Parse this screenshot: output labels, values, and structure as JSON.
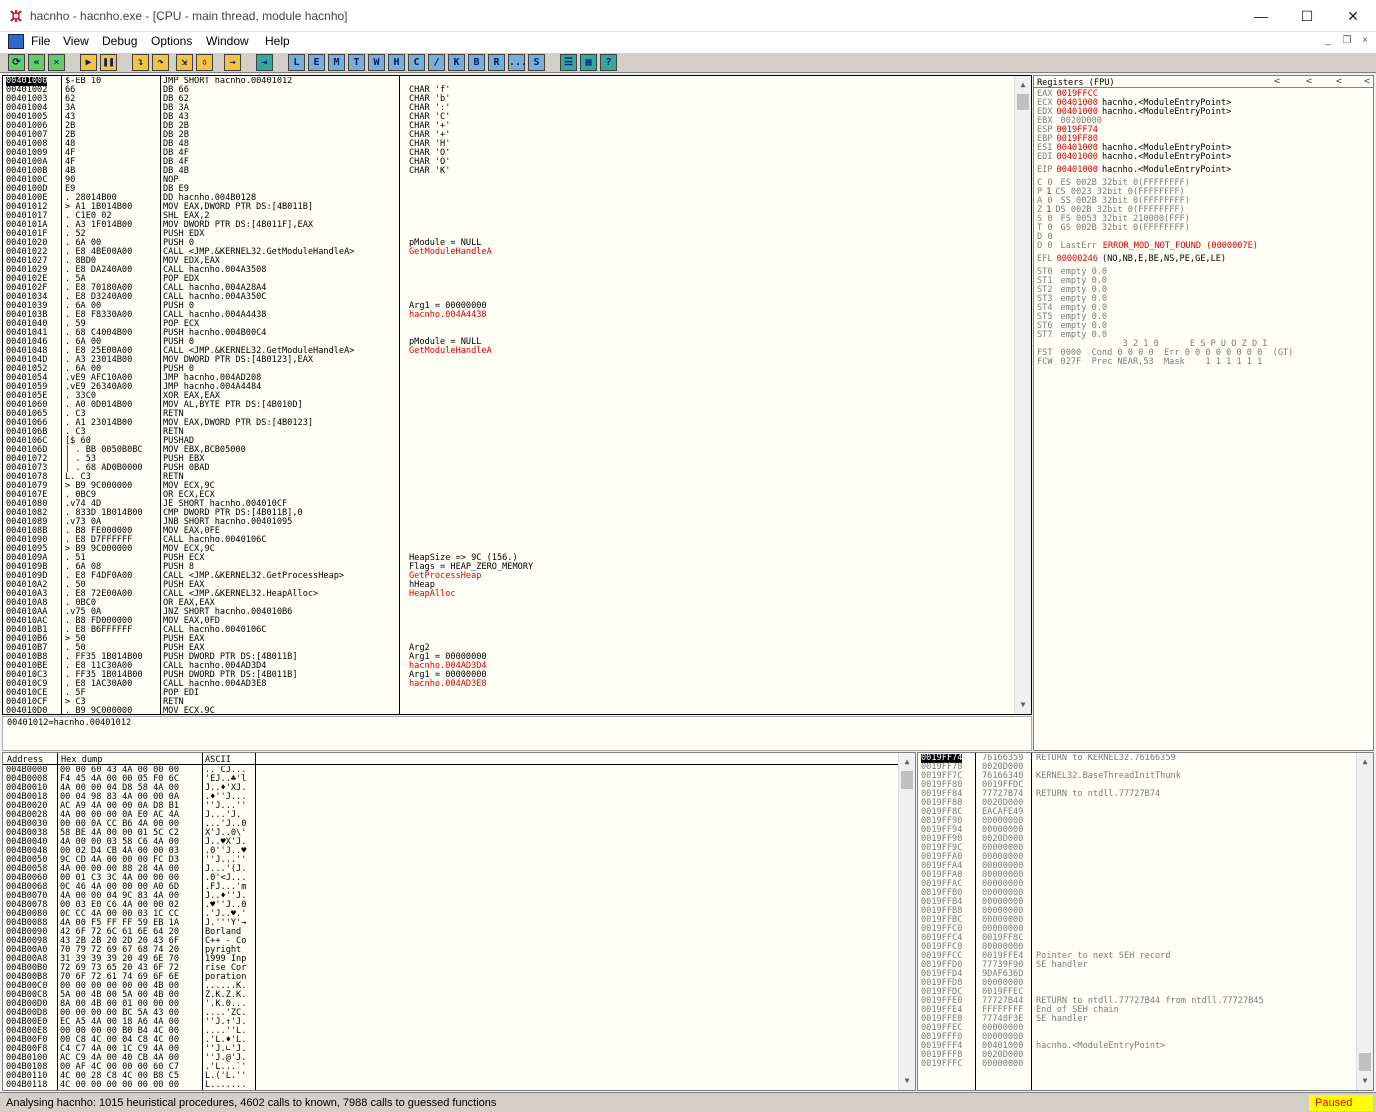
{
  "window": {
    "title": "hacnho - hacnho.exe - [CPU - main thread, module hacnho]",
    "minimize": "—",
    "maximize": "☐",
    "close": "✕"
  },
  "menu": [
    "File",
    "View",
    "Debug",
    "Options",
    "Window",
    "Help"
  ],
  "mdi": {
    "min": "_",
    "restore": "❐",
    "close": "×"
  },
  "toolbar": {
    "letters": [
      "L",
      "E",
      "M",
      "T",
      "W",
      "H",
      "C",
      "/",
      "K",
      "B",
      "R",
      "...",
      "S"
    ]
  },
  "cpu": {
    "rows": [
      [
        "00401000",
        "$-EB 10",
        "JMP SHORT hacnho.00401012",
        ""
      ],
      [
        "00401002",
        "66",
        "DB 66",
        "CHAR 'f'"
      ],
      [
        "00401003",
        "62",
        "DB 62",
        "CHAR 'b'"
      ],
      [
        "00401004",
        "3A",
        "DB 3A",
        "CHAR ':'"
      ],
      [
        "00401005",
        "43",
        "DB 43",
        "CHAR 'C'"
      ],
      [
        "00401006",
        "2B",
        "DB 2B",
        "CHAR '+'"
      ],
      [
        "00401007",
        "2B",
        "DB 2B",
        "CHAR '+'"
      ],
      [
        "00401008",
        "48",
        "DB 48",
        "CHAR 'H'"
      ],
      [
        "00401009",
        "4F",
        "DB 4F",
        "CHAR 'O'"
      ],
      [
        "0040100A",
        "4F",
        "DB 4F",
        "CHAR 'O'"
      ],
      [
        "0040100B",
        "4B",
        "DB 4B",
        "CHAR 'K'"
      ],
      [
        "0040100C",
        "90",
        "NOP",
        ""
      ],
      [
        "0040100D",
        "E9",
        "DB E9",
        ""
      ],
      [
        "0040100E",
        ". 28014B00",
        "DD hacnho.004B0128",
        ""
      ],
      [
        "00401012",
        "> A1 1B014B00",
        "MOV EAX,DWORD PTR DS:[4B011B]",
        ""
      ],
      [
        "00401017",
        ". C1E0 02",
        "SHL EAX,2",
        ""
      ],
      [
        "0040101A",
        ". A3 1F014B00",
        "MOV DWORD PTR DS:[4B011F],EAX",
        ""
      ],
      [
        "0040101F",
        ". 52",
        "PUSH EDX",
        ""
      ],
      [
        "00401020",
        ". 6A 00",
        "PUSH 0",
        "pModule = NULL"
      ],
      [
        "00401022",
        ". E8 4BE00A00",
        "CALL <JMP.&KERNEL32.GetModuleHandleA>",
        "GetModuleHandleA"
      ],
      [
        "00401027",
        ". 8BD0",
        "MOV EDX,EAX",
        ""
      ],
      [
        "00401029",
        ". E8 DA240A00",
        "CALL hacnho.004A3508",
        ""
      ],
      [
        "0040102E",
        ". 5A",
        "POP EDX",
        ""
      ],
      [
        "0040102F",
        ". E8 70180A00",
        "CALL hacnho.004A28A4",
        ""
      ],
      [
        "00401034",
        ". E8 D3240A00",
        "CALL hacnho.004A350C",
        ""
      ],
      [
        "00401039",
        ". 6A 00",
        "PUSH 0",
        "Arg1 = 00000000"
      ],
      [
        "0040103B",
        ". E8 F8330A00",
        "CALL hacnho.004A4438",
        "hacnho.004A4438"
      ],
      [
        "00401040",
        ". 59",
        "POP ECX",
        ""
      ],
      [
        "00401041",
        ". 68 C4004B00",
        "PUSH hacnho.004B00C4",
        ""
      ],
      [
        "00401046",
        ". 6A 00",
        "PUSH 0",
        "pModule = NULL"
      ],
      [
        "00401048",
        ". E8 25E00A00",
        "CALL <JMP.&KERNEL32.GetModuleHandleA>",
        "GetModuleHandleA"
      ],
      [
        "0040104D",
        ". A3 23014B00",
        "MOV DWORD PTR DS:[4B0123],EAX",
        ""
      ],
      [
        "00401052",
        ". 6A 00",
        "PUSH 0",
        ""
      ],
      [
        "00401054",
        ".vE9 AFC10A00",
        "JMP hacnho.004AD208",
        ""
      ],
      [
        "00401059",
        ".vE9 26340A00",
        "JMP hacnho.004A4484",
        ""
      ],
      [
        "0040105E",
        ". 33C0",
        "XOR EAX,EAX",
        ""
      ],
      [
        "00401060",
        ". A0 0D014B00",
        "MOV AL,BYTE PTR DS:[4B010D]",
        ""
      ],
      [
        "00401065",
        ". C3",
        "RETN",
        ""
      ],
      [
        "00401066",
        ". A1 23014B00",
        "MOV EAX,DWORD PTR DS:[4B0123]",
        ""
      ],
      [
        "0040106B",
        ". C3",
        "RETN",
        ""
      ],
      [
        "0040106C",
        "[$ 60",
        "PUSHAD",
        ""
      ],
      [
        "0040106D",
        "| . BB 0050B0BC",
        "MOV EBX,BCB05000",
        ""
      ],
      [
        "00401072",
        "| . 53",
        "PUSH EBX",
        ""
      ],
      [
        "00401073",
        "| . 68 AD0B0000",
        "PUSH 0BAD",
        ""
      ],
      [
        "00401078",
        "L. C3",
        "RETN",
        ""
      ],
      [
        "00401079",
        "> B9 9C000000",
        "MOV ECX,9C",
        ""
      ],
      [
        "0040107E",
        ". 0BC9",
        "OR ECX,ECX",
        ""
      ],
      [
        "00401080",
        ".v74 4D",
        "JE SHORT hacnho.004010CF",
        ""
      ],
      [
        "00401082",
        ". 833D 1B014B00",
        "CMP DWORD PTR DS:[4B011B],0",
        ""
      ],
      [
        "00401089",
        ".v73 0A",
        "JNB SHORT hacnho.00401095",
        ""
      ],
      [
        "0040108B",
        ". B8 FE000000",
        "MOV EAX,0FE",
        ""
      ],
      [
        "00401090",
        ". E8 D7FFFFFF",
        "CALL hacnho.0040106C",
        ""
      ],
      [
        "00401095",
        "> B9 9C000000",
        "MOV ECX,9C",
        ""
      ],
      [
        "0040109A",
        ". 51",
        "PUSH ECX",
        "HeapSize => 9C (156.)"
      ],
      [
        "0040109B",
        ". 6A 08",
        "PUSH 8",
        "Flags = HEAP_ZERO_MEMORY"
      ],
      [
        "0040109D",
        ". E8 F4DF0A00",
        "CALL <JMP.&KERNEL32.GetProcessHeap>",
        "GetProcessHeap"
      ],
      [
        "004010A2",
        ". 50",
        "PUSH EAX",
        "hHeap"
      ],
      [
        "004010A3",
        ". E8 72E00A00",
        "CALL <JMP.&KERNEL32.HeapAlloc>",
        "HeapAlloc"
      ],
      [
        "004010A8",
        ". 0BC0",
        "OR EAX,EAX",
        ""
      ],
      [
        "004010AA",
        ".v75 0A",
        "JNZ SHORT hacnho.004010B6",
        ""
      ],
      [
        "004010AC",
        ". B8 FD000000",
        "MOV EAX,0FD",
        ""
      ],
      [
        "004010B1",
        ". E8 B6FFFFFF",
        "CALL hacnho.0040106C",
        ""
      ],
      [
        "004010B6",
        "> 50",
        "PUSH EAX",
        ""
      ],
      [
        "004010B7",
        ". 50",
        "PUSH EAX",
        "Arg2"
      ],
      [
        "004010B8",
        ". FF35 1B014B00",
        "PUSH DWORD PTR DS:[4B011B]",
        "Arg1 = 00000000"
      ],
      [
        "004010BE",
        ". E8 11C30A00",
        "CALL hacnho.004AD3D4",
        "hacnho.004AD3D4"
      ],
      [
        "004010C3",
        ". FF35 1B014B00",
        "PUSH DWORD PTR DS:[4B011B]",
        "Arg1 = 00000000"
      ],
      [
        "004010C9",
        ". E8 1AC30A00",
        "CALL hacnho.004AD3E8",
        "hacnho.004AD3E8"
      ],
      [
        "004010CE",
        ". 5F",
        "POP EDI",
        ""
      ],
      [
        "004010CF",
        "> C3",
        "RETN",
        ""
      ],
      [
        "004010D0",
        ". B9 9C000000",
        "MOV ECX,9C",
        ""
      ]
    ]
  },
  "info": {
    "text": "00401012=hacnho.00401012"
  },
  "registers": {
    "title": "Registers (FPU)",
    "lines": [
      {
        "k": "EAX",
        "v": "0019FFCC",
        "n": ""
      },
      {
        "k": "ECX",
        "v": "00401000",
        "n": "hacnho.<ModuleEntryPoint>"
      },
      {
        "k": "EDX",
        "v": "00401000",
        "n": "hacnho.<ModuleEntryPoint>"
      },
      {
        "k": "EBX",
        "v": "",
        "n": "",
        "g": "0020D000"
      },
      {
        "k": "ESP",
        "v": "0019FF74",
        "n": ""
      },
      {
        "k": "EBP",
        "v": "0019FF80",
        "n": ""
      },
      {
        "k": "ESI",
        "v": "00401000",
        "n": "hacnho.<ModuleEntryPoint>"
      },
      {
        "k": "EDI",
        "v": "00401000",
        "n": "hacnho.<ModuleEntryPoint>"
      },
      {
        "k": "",
        "v": "",
        "n": ""
      },
      {
        "k": "EIP",
        "v": "00401000",
        "n": "hacnho.<ModuleEntryPoint>"
      },
      {
        "k": "",
        "v": "",
        "n": ""
      },
      {
        "k": "C 0",
        "v": "",
        "n": "",
        "g": "ES 002B 32bit 0(FFFFFFFF)"
      },
      {
        "k": "P",
        "v": "1",
        "n": "",
        "g": "CS 0023 32bit 0(FFFFFFFF)"
      },
      {
        "k": "A 0",
        "v": "",
        "n": "",
        "g": "SS 002B 32bit 0(FFFFFFFF)"
      },
      {
        "k": "Z",
        "v": "1",
        "n": "",
        "g": "DS 002B 32bit 0(FFFFFFFF)"
      },
      {
        "k": "S 0",
        "v": "",
        "n": "",
        "g": "FS 0053 32bit 210000(FFF)"
      },
      {
        "k": "T 0",
        "v": "",
        "n": "",
        "g": "GS 002B 32bit 0(FFFFFFFF)"
      },
      {
        "k": "D 0",
        "v": "",
        "n": ""
      },
      {
        "k": "O 0",
        "v": "",
        "n": "",
        "g": "LastErr",
        "e": "ERROR_MOD_NOT_FOUND (0000007E)"
      },
      {
        "k": "",
        "v": "",
        "n": ""
      },
      {
        "k": "EFL",
        "v": "00000246",
        "n": "(NO,NB,E,BE,NS,PE,GE,LE)"
      },
      {
        "k": "",
        "v": "",
        "n": ""
      },
      {
        "k": "ST0",
        "v": "",
        "n": "",
        "g": "empty 0.0"
      },
      {
        "k": "ST1",
        "v": "",
        "n": "",
        "g": "empty 0.0"
      },
      {
        "k": "ST2",
        "v": "",
        "n": "",
        "g": "empty 0.0"
      },
      {
        "k": "ST3",
        "v": "",
        "n": "",
        "g": "empty 0.0"
      },
      {
        "k": "ST4",
        "v": "",
        "n": "",
        "g": "empty 0.0"
      },
      {
        "k": "ST5",
        "v": "",
        "n": "",
        "g": "empty 0.0"
      },
      {
        "k": "ST6",
        "v": "",
        "n": "",
        "g": "empty 0.0"
      },
      {
        "k": "ST7",
        "v": "",
        "n": "",
        "g": "empty 0.0"
      },
      {
        "k": "",
        "v": "",
        "n": "",
        "g": "               3 2 1 0      E S P U O Z D I"
      },
      {
        "k": "FST",
        "v": "",
        "n": "",
        "g": "0000  Cond 0 0 0 0  Err 0 0 0 0 0 0 0 0  (GT)"
      },
      {
        "k": "FCW",
        "v": "",
        "n": "",
        "g": "027F  Prec NEAR,53  Mask    1 1 1 1 1 1"
      }
    ]
  },
  "dump": {
    "headers": {
      "address": "Address",
      "hex": "Hex dump",
      "ascii": "ASCII"
    },
    "rows": [
      [
        "004B0000",
        "00 00 60 43 4A 00 00 00",
        "..`CJ..."
      ],
      [
        "004B0008",
        "F4 45 4A 00 00 05 F0 6C",
        "'EJ..♣'l"
      ],
      [
        "004B0010",
        "4A 00 00 04 D8 58 4A 00",
        "J..♦'XJ."
      ],
      [
        "004B0018",
        "00 04 98 83 4A 00 00 0A",
        ".♦''J..."
      ],
      [
        "004B0020",
        "AC A9 4A 00 00 0A D8 B1",
        "''J...''"
      ],
      [
        "004B0028",
        "4A 00 00 00 0A E0 AC 4A",
        "J...'J."
      ],
      [
        "004B0030",
        "00 00 0A CC B6 4A 00 00",
        "...'J..0"
      ],
      [
        "004B0038",
        "58 BE 4A 00 00 01 5C C2",
        "X'J..0\\'"
      ],
      [
        "004B0040",
        "4A 00 00 03 58 C6 4A 00",
        "J..♥X'J."
      ],
      [
        "004B0048",
        "00 02 D4 CB 4A 00 00 03",
        ".0''J..♥"
      ],
      [
        "004B0050",
        "9C CD 4A 00 00 00 FC D3",
        "''J...''"
      ],
      [
        "004B0058",
        "4A 00 00 00 88 28 4A 00",
        "J...'(J."
      ],
      [
        "004B0060",
        "00 01 C3 3C 4A 00 00 00",
        ".0'<J..."
      ],
      [
        "004B0068",
        "0C 46 4A 00 00 00 A0 6D",
        ".FJ...'m"
      ],
      [
        "004B0070",
        "4A 00 00 04 9C 83 4A 00",
        "J..♦''J."
      ],
      [
        "004B0078",
        "00 03 E0 C6 4A 00 00 02",
        ".♥''J..0"
      ],
      [
        "004B0080",
        "0C CC 4A 00 00 03 1C CC",
        ".'J..♥.'"
      ],
      [
        "004B0088",
        "4A 00 F5 FF FF 59 EB 1A",
        "J.'''Y'→"
      ],
      [
        "004B0090",
        "42 6F 72 6C 61 6E 64 20",
        "Borland "
      ],
      [
        "004B0098",
        "43 2B 2B 20 2D 20 43 6F",
        "C++ - Co"
      ],
      [
        "004B00A0",
        "70 79 72 69 67 68 74 20",
        "pyright "
      ],
      [
        "004B00A8",
        "31 39 39 39 20 49 6E 70",
        "1999 Inp"
      ],
      [
        "004B00B0",
        "72 69 73 65 20 43 6F 72",
        "rise Cor"
      ],
      [
        "004B00B8",
        "70 6F 72 61 74 69 6F 6E",
        "poration"
      ],
      [
        "004B00C0",
        "00 00 00 00 00 00 4B 00",
        "......K."
      ],
      [
        "004B00C8",
        "5A 00 4B 00 5A 00 4B 00",
        "Z.K.Z.K."
      ],
      [
        "004B00D0",
        "8A 00 4B 00 01 00 00 00",
        "'.K.0..."
      ],
      [
        "004B00D8",
        "00 00 00 00 BC 5A 43 00",
        "....'ZC."
      ],
      [
        "004B00E0",
        "EC A5 4A 00 18 A6 4A 00",
        "''J.↑'J."
      ],
      [
        "004B00E8",
        "00 00 00 00 B0 B4 4C 00",
        "....''L."
      ],
      [
        "004B00F0",
        "00 C8 4C 00 04 C8 4C 00",
        ".'L.♦'L."
      ],
      [
        "004B00F8",
        "C4 C7 4A 00 1C C9 4A 00",
        "''J.∟'J."
      ],
      [
        "004B0100",
        "AC C9 4A 00 40 CB 4A 00",
        "''J.@'J."
      ],
      [
        "004B0108",
        "00 AF 4C 00 00 00 60 C7",
        ".'L...`'"
      ],
      [
        "004B0110",
        "4C 00 28 C8 4C 00 B8 C5",
        "L.('L.''"
      ],
      [
        "004B0118",
        "4C 00 00 00 00 00 00 00",
        "L......."
      ]
    ]
  },
  "stack": {
    "rows": [
      [
        "0019FF74",
        "76166359",
        "RETURN to KERNEL32.76166359"
      ],
      [
        "0019FF78",
        "0020D000",
        ""
      ],
      [
        "0019FF7C",
        "76166340",
        "KERNEL32.BaseThreadInitThunk"
      ],
      [
        "0019FF80",
        "0019FFDC",
        ""
      ],
      [
        "0019FF84",
        "77727B74",
        "RETURN to ntdll.77727B74"
      ],
      [
        "0019FF88",
        "0020D000",
        ""
      ],
      [
        "0019FF8C",
        "EACAFE49",
        ""
      ],
      [
        "0019FF90",
        "00000000",
        ""
      ],
      [
        "0019FF94",
        "00000000",
        ""
      ],
      [
        "0019FF98",
        "0020D000",
        ""
      ],
      [
        "0019FF9C",
        "00000000",
        ""
      ],
      [
        "0019FFA0",
        "00000000",
        ""
      ],
      [
        "0019FFA4",
        "00000000",
        ""
      ],
      [
        "0019FFA8",
        "00000000",
        ""
      ],
      [
        "0019FFAC",
        "00000000",
        ""
      ],
      [
        "0019FFB0",
        "00000000",
        ""
      ],
      [
        "0019FFB4",
        "00000000",
        ""
      ],
      [
        "0019FFB8",
        "00000000",
        ""
      ],
      [
        "0019FFBC",
        "00000000",
        ""
      ],
      [
        "0019FFC0",
        "00000000",
        ""
      ],
      [
        "0019FFC4",
        "0019FF8C",
        ""
      ],
      [
        "0019FFC8",
        "00000000",
        ""
      ],
      [
        "0019FFCC",
        "0019FFE4",
        "Pointer to next SEH record"
      ],
      [
        "0019FFD0",
        "77739F90",
        "SE handler"
      ],
      [
        "0019FFD4",
        "9DAF636D",
        ""
      ],
      [
        "0019FFD8",
        "00000000",
        ""
      ],
      [
        "0019FFDC",
        "0019FFEC",
        ""
      ],
      [
        "0019FFE0",
        "77727B44",
        "RETURN to ntdll.77727B44 from ntdll.77727B45"
      ],
      [
        "0019FFE4",
        "FFFFFFFF",
        "End of SEH chain"
      ],
      [
        "0019FFE8",
        "77748F3E",
        "SE handler"
      ],
      [
        "0019FFEC",
        "00000000",
        ""
      ],
      [
        "0019FFF0",
        "00000000",
        ""
      ],
      [
        "0019FFF4",
        "00401000",
        "hacnho.<ModuleEntryPoint>"
      ],
      [
        "0019FFF8",
        "0020D000",
        ""
      ],
      [
        "0019FFFC",
        "00000000",
        ""
      ]
    ]
  },
  "status": {
    "text": "Analysing hacnho: 1015 heuristical procedures, 4602 calls to known, 7988 calls to guessed functions",
    "state": "Paused"
  }
}
